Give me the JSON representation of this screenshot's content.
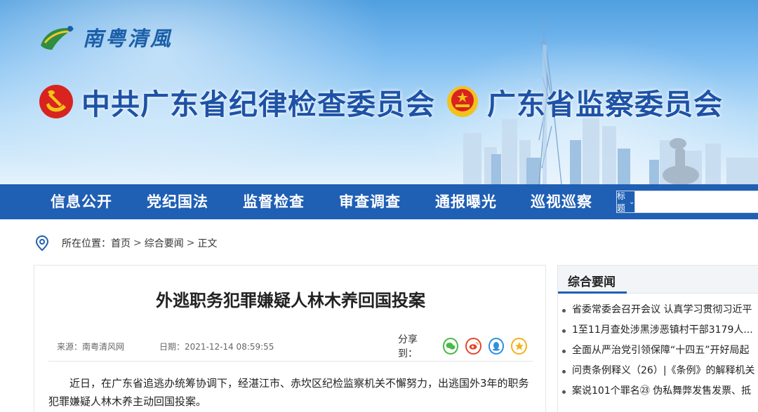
{
  "header": {
    "brand": "南粤清風",
    "org1": "中共广东省纪律检查委员会",
    "org2": "广东省监察委员会"
  },
  "nav": {
    "items": [
      "信息公开",
      "党纪国法",
      "监督检查",
      "审查调查",
      "通报曝光",
      "巡视巡察"
    ]
  },
  "search": {
    "select_label": "标题",
    "placeholder": ""
  },
  "breadcrumb": {
    "prefix": "所在位置：",
    "home": "首页",
    "section": "综合要闻",
    "current": "正文",
    "sep": ">"
  },
  "article": {
    "title": "外逃职务犯罪嫌疑人林木养回国投案",
    "source": "来源：南粤清风网",
    "date": "日期：2021-12-14 08:59:55",
    "share_label": "分享到：",
    "share_icons": [
      "wechat-icon",
      "weibo-icon",
      "qq-icon",
      "qzone-icon"
    ],
    "body": "近日，在广东省追逃办统筹协调下，经湛江市、赤坎区纪检监察机关不懈努力，出逃国外3年的职务犯罪嫌疑人林木养主动回国投案。"
  },
  "sidebar": {
    "title": "综合要闻",
    "items": [
      "省委常委会召开会议 认真学习贯彻习近平",
      "1至11月查处涉黑涉恶镇村干部3179人...",
      "全面从严治党引领保障“十四五”开好局起",
      "问责条例释义（26）|《条例》的解释机关",
      "案说101个罪名㉓ 伪私舞弊发售发票、抵"
    ]
  },
  "colors": {
    "nav_bg": "#1f5fb4",
    "title_blue": "#1d52a6",
    "party_red": "#d8231f",
    "gold": "#f3c21b"
  }
}
